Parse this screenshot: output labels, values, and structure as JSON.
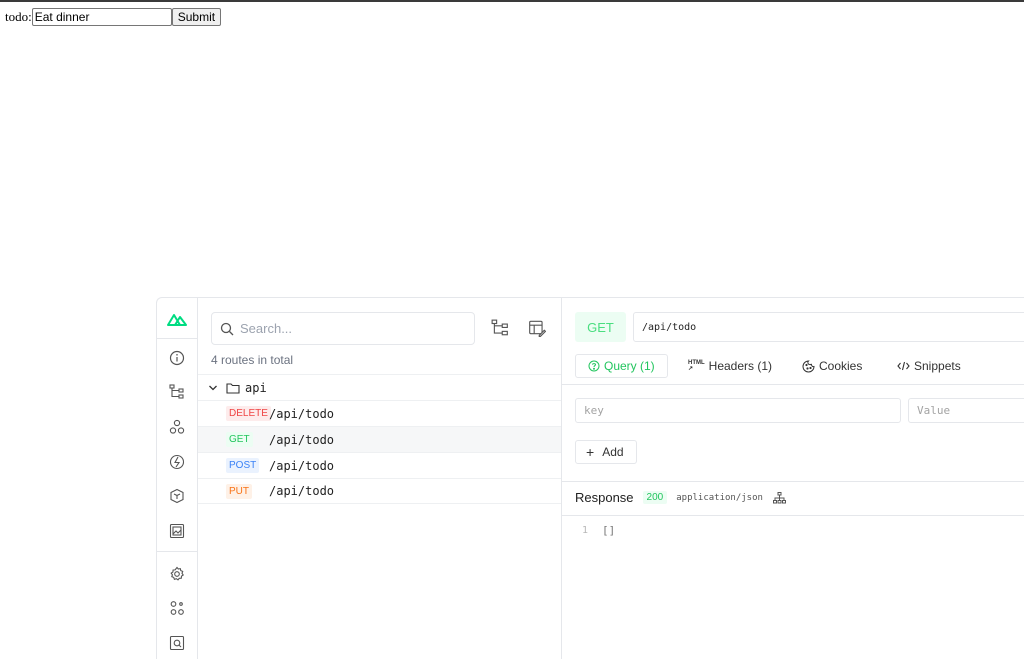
{
  "form": {
    "label": "todo:",
    "input_value": "Eat dinner",
    "submit_label": "Submit"
  },
  "rail": {
    "icons": [
      "nuxt-logo-icon",
      "info-icon",
      "tree-icon",
      "components-icon",
      "hooks-icon",
      "modules-icon",
      "assets-icon",
      "settings-icon",
      "plugins-icon",
      "inspect-icon"
    ]
  },
  "routes": {
    "search_placeholder": "Search...",
    "count_text": "4 routes in total",
    "folder": "api",
    "items": [
      {
        "method": "DELETE",
        "path": "/api/todo"
      },
      {
        "method": "GET",
        "path": "/api/todo"
      },
      {
        "method": "POST",
        "path": "/api/todo"
      },
      {
        "method": "PUT",
        "path": "/api/todo"
      }
    ]
  },
  "colors": {
    "accent": "#22c55e",
    "delete": "#ef4444",
    "get": "#22c55e",
    "post": "#3b82f6",
    "put": "#f97316"
  },
  "request": {
    "method": "GET",
    "url": "/api/todo",
    "tabs": {
      "query": "Query (1)",
      "headers": "Headers (1)",
      "cookies": "Cookies",
      "snippets": "Snippets"
    },
    "key_placeholder": "key",
    "value_placeholder": "Value",
    "add_label": "Add"
  },
  "response": {
    "label": "Response",
    "status": "200",
    "content_type": "application/json",
    "line_number": "1",
    "body": "[]"
  }
}
